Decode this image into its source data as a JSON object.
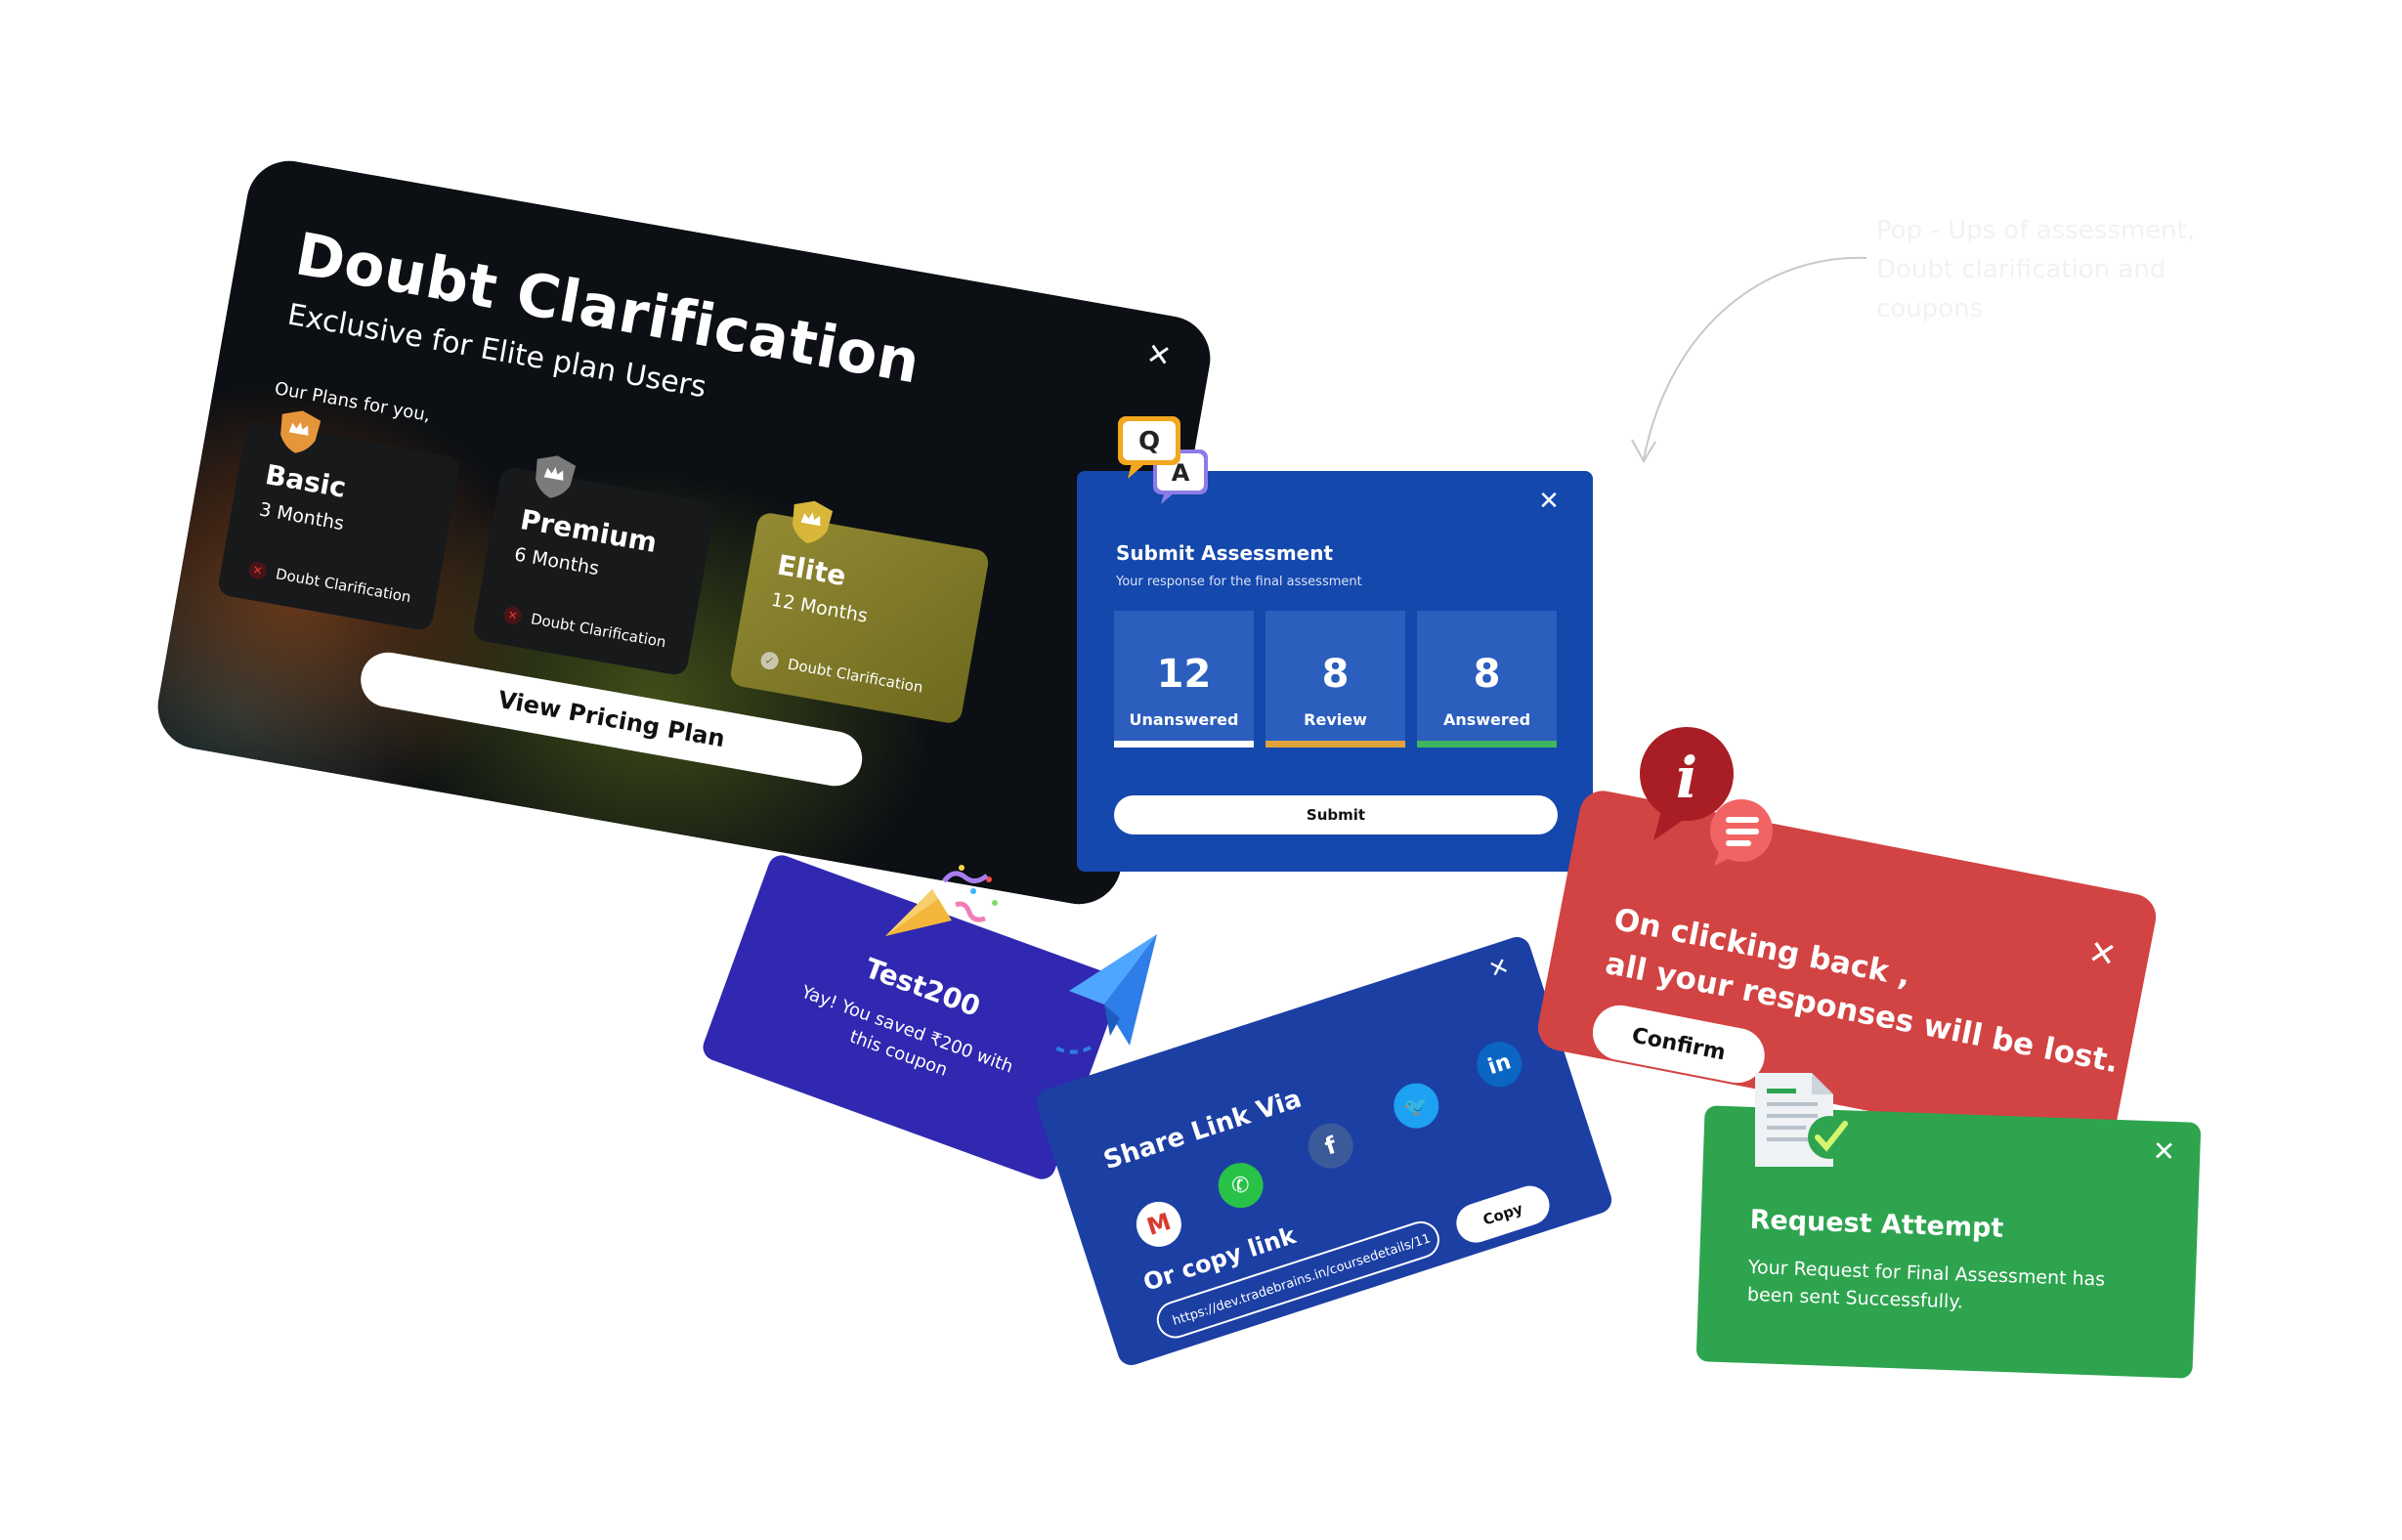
{
  "doubt_modal": {
    "title": "Doubt Clarification",
    "subtitle": "Exclusive for Elite plan Users",
    "plans_label": "Our Plans for you,",
    "plans": [
      {
        "name": "Basic",
        "duration": "3 Months",
        "feature": "Doubt Clarification",
        "included": false,
        "shield_color": "#e6963a"
      },
      {
        "name": "Premium",
        "duration": "6 Months",
        "feature": "Doubt Clarification",
        "included": false,
        "shield_color": "#7b7b7b"
      },
      {
        "name": "Elite",
        "duration": "12 Months",
        "feature": "Doubt Clarification",
        "included": true,
        "shield_color": "#d8b63a"
      }
    ],
    "cta_label": "View Pricing Plan",
    "close_icon": "close-icon"
  },
  "assessment_modal": {
    "badge_q": "Q",
    "badge_a": "A",
    "title": "Submit Assessment",
    "subtitle": "Your response for the final assessment",
    "stats": [
      {
        "value": "12",
        "label": "Unanswered",
        "color": "#ffffff"
      },
      {
        "value": "8",
        "label": "Review",
        "color": "#e0a33e"
      },
      {
        "value": "8",
        "label": "Answered",
        "color": "#3fb55f"
      }
    ],
    "submit_label": "Submit",
    "background": "#1448ad"
  },
  "coupon_modal": {
    "code": "Test200",
    "message": "Yay! You saved ₹200 with this coupon",
    "background": "#3028b0"
  },
  "share_modal": {
    "title": "Share Link Via",
    "icons": [
      "gmail-icon",
      "whatsapp-icon",
      "facebook-icon",
      "twitter-icon",
      "linkedin-icon"
    ],
    "copy_label": "Or copy link",
    "link": "https://dev.tradebrains.in/coursedetails/11",
    "copy_button": "Copy",
    "background": "#1c3fa4"
  },
  "back_modal": {
    "line1": "On clicking back ,",
    "line2": "all your responses will be lost.",
    "confirm_label": "Confirm",
    "background": "#d24343"
  },
  "request_modal": {
    "title": "Request Attempt",
    "message": "Your Request for Final Assessment has been sent Successfully.",
    "background": "#2ea44f"
  },
  "annotation": {
    "text": "Pop - Ups of assessment, Doubt clarification and coupons"
  }
}
